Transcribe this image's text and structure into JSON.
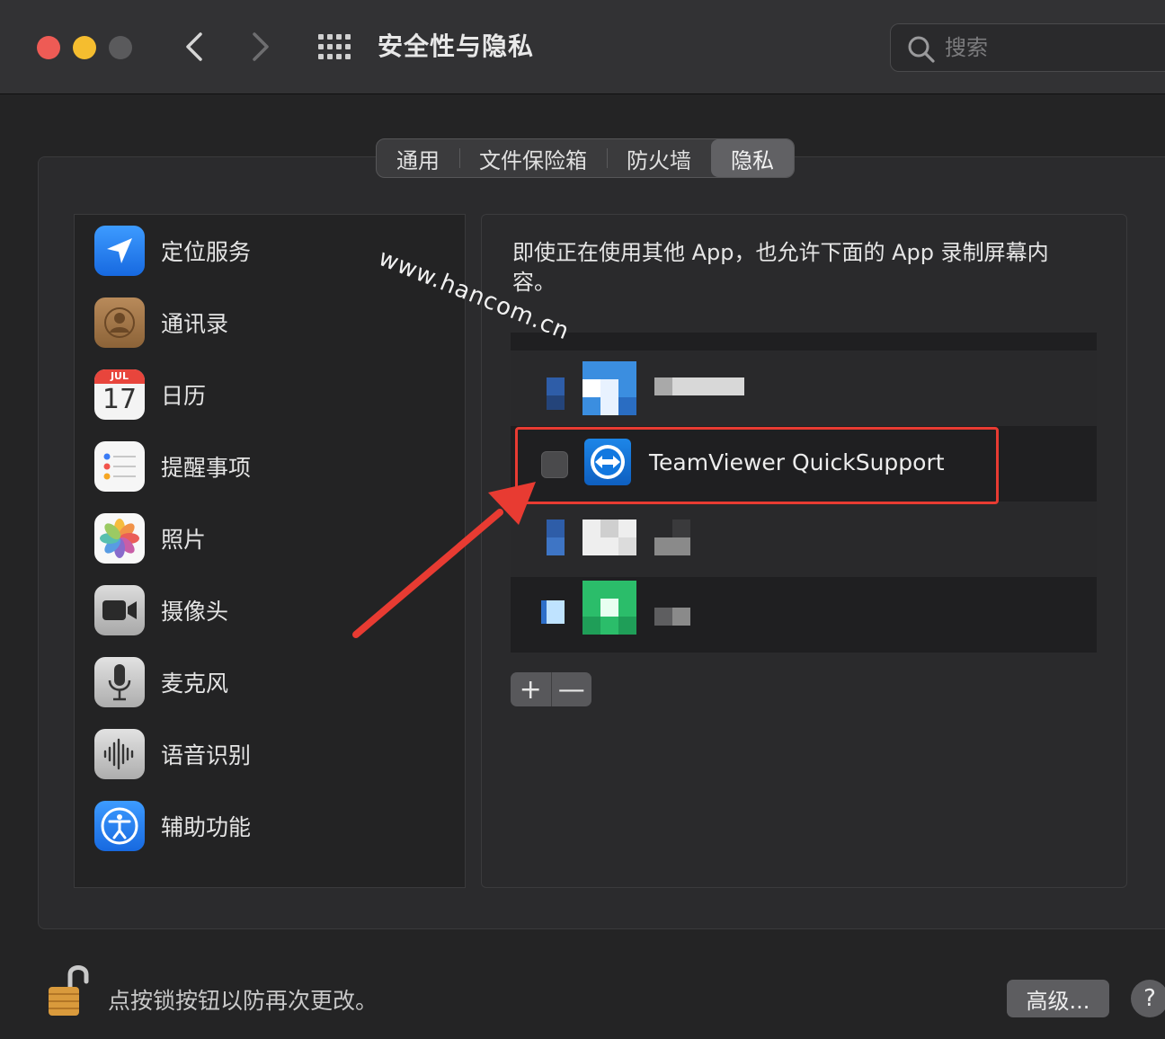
{
  "window": {
    "title": "安全性与隐私",
    "search_placeholder": "搜索"
  },
  "tabs": [
    {
      "label": "通用",
      "active": false
    },
    {
      "label": "文件保险箱",
      "active": false
    },
    {
      "label": "防火墙",
      "active": false
    },
    {
      "label": "隐私",
      "active": true
    }
  ],
  "sidebar": {
    "items": [
      {
        "label": "定位服务",
        "icon": "location-arrow-icon"
      },
      {
        "label": "通讯录",
        "icon": "contacts-icon"
      },
      {
        "label": "日历",
        "icon": "calendar-icon",
        "month": "JUL",
        "day": "17"
      },
      {
        "label": "提醒事项",
        "icon": "reminders-icon"
      },
      {
        "label": "照片",
        "icon": "photos-icon"
      },
      {
        "label": "摄像头",
        "icon": "camera-icon"
      },
      {
        "label": "麦克风",
        "icon": "microphone-icon"
      },
      {
        "label": "语音识别",
        "icon": "speech-recognition-icon"
      },
      {
        "label": "辅助功能",
        "icon": "accessibility-icon"
      }
    ]
  },
  "content": {
    "description": "即使正在使用其他 App，也允许下面的 App 录制屏幕内容。",
    "apps": [
      {
        "name": "",
        "checked": false,
        "blurred": true
      },
      {
        "name": "TeamViewer QuickSupport",
        "checked": false,
        "blurred": false
      },
      {
        "name": "",
        "checked": false,
        "blurred": true
      },
      {
        "name": "",
        "checked": false,
        "blurred": true
      }
    ],
    "add_label": "+",
    "remove_label": "—"
  },
  "watermark": "www.hancom.cn",
  "footer": {
    "lock_text": "点按锁按钮以防再次更改。",
    "advanced_label": "高级...",
    "help_label": "?"
  },
  "colors": {
    "highlight": "#e83b32",
    "arrow": "#e83b32"
  }
}
